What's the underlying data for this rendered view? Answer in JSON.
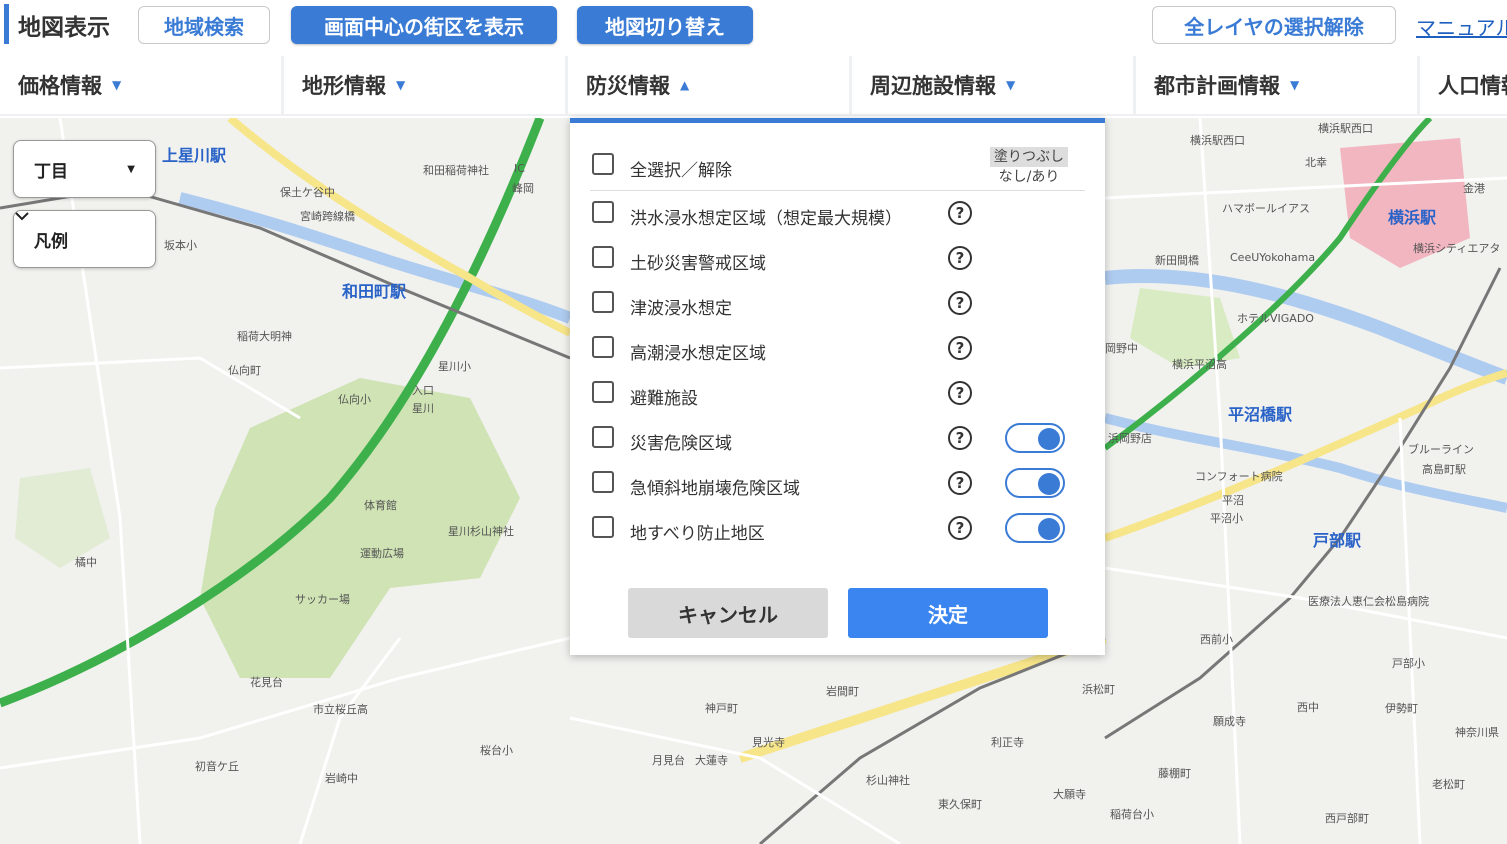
{
  "header": {
    "title": "地図表示",
    "buttons": {
      "region_search": "地域検索",
      "show_center_block": "画面中心の街区を表示",
      "switch_map": "地図切り替え",
      "deselect_all_layers": "全レイヤの選択解除",
      "manual": "マニュアル"
    }
  },
  "tabs": [
    {
      "label": "価格情報",
      "caret": "▼"
    },
    {
      "label": "地形情報",
      "caret": "▼"
    },
    {
      "label": "防災情報",
      "caret": "▲"
    },
    {
      "label": "周辺施設情報",
      "caret": "▼"
    },
    {
      "label": "都市計画情報",
      "caret": "▼"
    },
    {
      "label": "人口情報"
    }
  ],
  "map_controls": {
    "chome": "丁目",
    "legend": "凡例"
  },
  "disaster_panel": {
    "select_all": "全選択／解除",
    "fill_header_top": "塗りつぶし",
    "fill_header_bottom": "なし/あり",
    "items": [
      {
        "label": "洪水浸水想定区域（想定最大規模）",
        "checked": false,
        "help": "?"
      },
      {
        "label": "土砂災害警戒区域",
        "checked": false,
        "help": "?"
      },
      {
        "label": "津波浸水想定",
        "checked": false,
        "help": "?"
      },
      {
        "label": "高潮浸水想定区域",
        "checked": false,
        "help": "?"
      },
      {
        "label": "避難施設",
        "checked": false,
        "help": "?"
      },
      {
        "label": "災害危険区域",
        "checked": false,
        "help": "?",
        "fill": true
      },
      {
        "label": "急傾斜地崩壊危険区域",
        "checked": false,
        "help": "?",
        "fill": true
      },
      {
        "label": "地すべり防止地区",
        "checked": false,
        "help": "?",
        "fill": true
      }
    ],
    "cancel": "キャンセル",
    "ok": "決定"
  },
  "map_labels": {
    "stations": [
      "上星川駅",
      "和田町駅",
      "横浜駅",
      "平沼橋駅",
      "戸部駅"
    ],
    "places": [
      "保土ケ谷中",
      "宮崎跨線橋",
      "坂本小",
      "和田稲荷神社",
      "稲荷大明神",
      "仏向町",
      "仏向小",
      "星川小",
      "体育館",
      "星川杉山神社",
      "運動広場",
      "サッカー場",
      "橘中",
      "花見台",
      "市立桜丘高",
      "桜台小",
      "岩崎中",
      "初音ケ丘",
      "神戸町",
      "見光寺",
      "月見台",
      "大蓮寺",
      "杉山神社",
      "東久保町",
      "岩間町",
      "利正寺",
      "浜松町",
      "西前小",
      "藤棚町",
      "大願寺",
      "稲荷台小",
      "願成寺",
      "西中",
      "戸部小",
      "医療法人恵仁会松島病院",
      "高島町駅",
      "ホテルVIGADO",
      "CeeUYokohama",
      "ハマボールイアス",
      "横浜平沼高",
      "コンフォート病院",
      "平沼小",
      "西戸部町",
      "伊勢町",
      "神奈川県",
      "老松町",
      "北幸",
      "横浜シティエアタ",
      "新田間橋",
      "平沼",
      "岡野中",
      "浜岡野店",
      "ブルーライン",
      "横浜駅西口",
      "横浜駅西口",
      "金港",
      "入口",
      "星川",
      "IC",
      "峰岡"
    ]
  },
  "colors": {
    "accent": "#3a7bd5",
    "ok_button": "#3a85f0",
    "park": "#cfe3b4",
    "river": "#aecbf0",
    "highway": "#3db04c",
    "road": "#f7e58a",
    "station_area": "#f2a8b4"
  }
}
